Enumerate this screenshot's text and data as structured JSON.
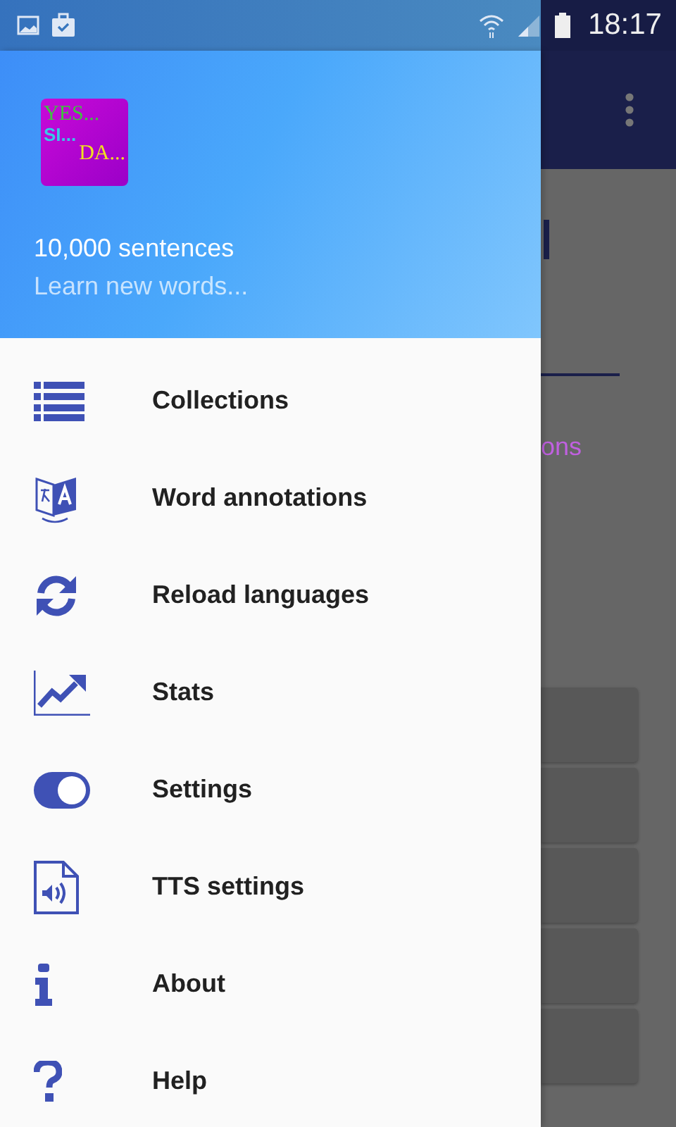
{
  "status_bar": {
    "time": "18:17"
  },
  "drawer": {
    "logo_lines": [
      "YES...",
      "SI...",
      "DA..."
    ],
    "title": "10,000 sentences",
    "subtitle": "Learn new words...",
    "items": [
      {
        "label": "Collections"
      },
      {
        "label": "Word annotations"
      },
      {
        "label": "Reload languages"
      },
      {
        "label": "Stats"
      },
      {
        "label": "Settings"
      },
      {
        "label": "TTS settings"
      },
      {
        "label": "About"
      },
      {
        "label": "Help"
      }
    ]
  },
  "background": {
    "text_fragment": "ons"
  }
}
